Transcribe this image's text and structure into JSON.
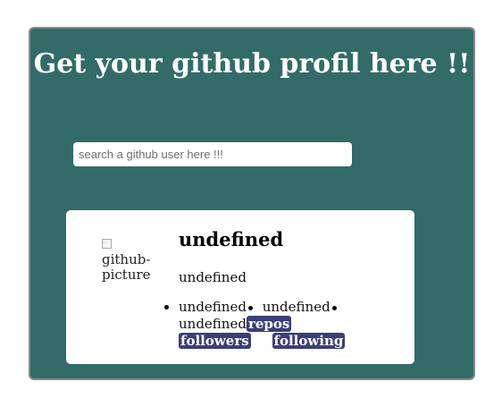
{
  "header": {
    "title": "Get your github profil here !!"
  },
  "search": {
    "placeholder": "search a github user here !!!",
    "value": ""
  },
  "profile": {
    "avatar_alt": "github-picture",
    "name": "undefined",
    "bio": "undefined",
    "stats": [
      {
        "value": "undefined",
        "label": "followers"
      },
      {
        "value": "undefined",
        "label": "following"
      },
      {
        "value": "undefined",
        "label": "repos"
      }
    ]
  },
  "colors": {
    "background": "#336b69",
    "card": "#ffffff",
    "tag": "#3b3f77"
  }
}
